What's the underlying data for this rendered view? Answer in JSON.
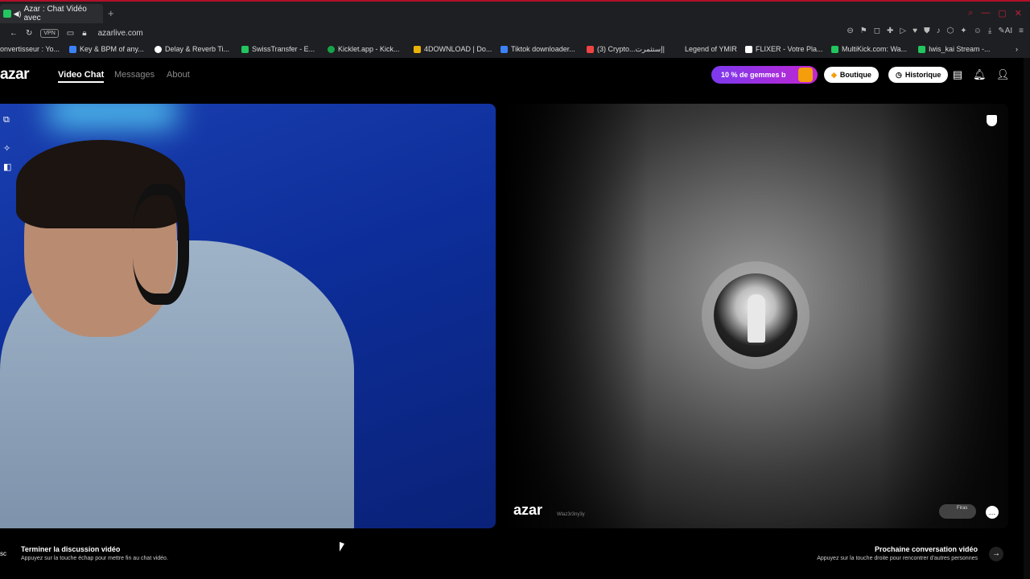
{
  "browser": {
    "tab_title": "Azar : Chat Vidéo avec",
    "url": "azarlive.com",
    "vpn_label": "VPN",
    "bookmarks": [
      {
        "label": "onvertisseur : Yo...",
        "color": "#ffffff"
      },
      {
        "label": "Key & BPM of any...",
        "color": "#3b82f6"
      },
      {
        "label": "Delay & Reverb Ti...",
        "color": "#ffffff"
      },
      {
        "label": "SwissTransfer - E...",
        "color": "#22c55e"
      },
      {
        "label": "Kicklet.app - Kick...",
        "color": "#16a34a"
      },
      {
        "label": "4DOWNLOAD | Do...",
        "color": "#eab308"
      },
      {
        "label": "Tiktok downloader...",
        "color": "#3b82f6"
      },
      {
        "label": "(3) Crypto...إستثمرت|",
        "color": "#ef4444"
      },
      {
        "label": "Legend of YMIR",
        "color": ""
      },
      {
        "label": "FLIXER - Votre Pla...",
        "color": "#ffffff"
      },
      {
        "label": "MultiKick.com: Wa...",
        "color": "#22c55e"
      },
      {
        "label": "Iwis_kai Stream -...",
        "color": "#22c55e"
      }
    ]
  },
  "app": {
    "logo": "azar",
    "nav": [
      {
        "label": "Video Chat",
        "active": true
      },
      {
        "label": "Messages",
        "active": false
      },
      {
        "label": "About",
        "active": false
      }
    ],
    "promo_label": "10 % de gemmes b",
    "shop_label": "Boutique",
    "history_label": "Historique"
  },
  "remote": {
    "watermark": "azar",
    "watermark_sub": "Wlaz3r3ny3y",
    "mini_label": "Firas"
  },
  "footer": {
    "esc_label": "sc",
    "end_title": "Terminer la discussion vidéo",
    "end_sub": "Appuyez sur la touche échap pour mettre fin au chat vidéo.",
    "next_title": "Prochaine conversation vidéo",
    "next_sub": "Appuyez sur la touche droite pour rencontrer d'autres personnes"
  },
  "colors": {
    "promo_gradient_start": "#7c3aed",
    "promo_gradient_end": "#c026d3",
    "left_video_bg": "#0d2e9a"
  }
}
